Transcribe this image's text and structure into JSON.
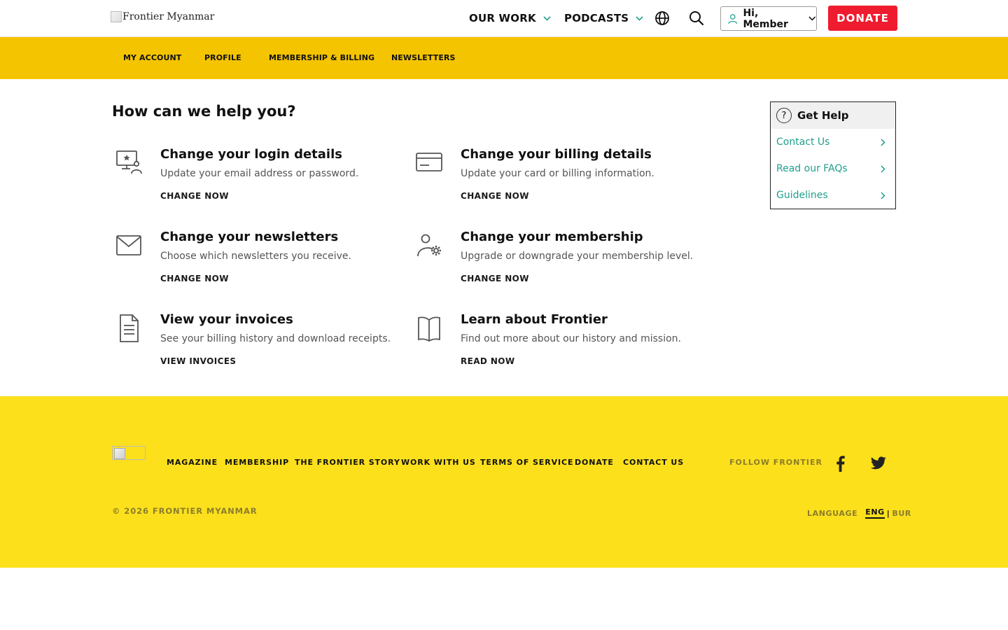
{
  "header": {
    "logo_alt": "Frontier Myanmar",
    "nav": [
      {
        "label": "OUR WORK"
      },
      {
        "label": "PODCASTS"
      }
    ],
    "member_label": "Hi, Member",
    "donate_label": "DONATE"
  },
  "subnav": {
    "items": [
      "MY ACCOUNT",
      "PROFILE",
      "MEMBERSHIP & BILLING",
      "NEWSLETTERS"
    ]
  },
  "main": {
    "title": "How can we help you?",
    "cards": [
      {
        "icon": "user-monitor-icon",
        "title": "Change your login details",
        "desc": "Update your email address or password.",
        "link": "CHANGE NOW"
      },
      {
        "icon": "credit-card-icon",
        "title": "Change your billing details",
        "desc": "Update your card or billing information.",
        "link": "CHANGE NOW"
      },
      {
        "icon": "envelope-icon",
        "title": "Change your newsletters",
        "desc": "Choose which newsletters you receive.",
        "link": "CHANGE NOW"
      },
      {
        "icon": "user-settings-icon",
        "title": "Change your membership",
        "desc": "Upgrade or downgrade your membership level.",
        "link": "CHANGE NOW"
      },
      {
        "icon": "document-icon",
        "title": "View your invoices",
        "desc": "See your billing history and download receipts.",
        "link": "VIEW INVOICES"
      },
      {
        "icon": "book-icon",
        "title": "Learn about Frontier",
        "desc": "Find out more about our history and mission.",
        "link": "READ NOW"
      }
    ]
  },
  "help": {
    "title": "Get Help",
    "items": [
      "Contact Us",
      "Read our FAQs",
      "Guidelines"
    ],
    "link_color": "#1f9f8c"
  },
  "footer": {
    "links": [
      "MAGAZINE",
      "MEMBERSHIP",
      "THE FRONTIER STORY",
      "WORK WITH US",
      "TERMS OF SERVICE",
      "DONATE",
      "CONTACT US"
    ],
    "follow": "FOLLOW FRONTIER",
    "copyright": "© 2026 FRONTIER MYANMAR",
    "language_label": "LANGUAGE",
    "lang_current": "ENG",
    "lang_other": "BUR",
    "background": "#fde01c"
  },
  "colors": {
    "accent_yellow": "#f5c400",
    "donate_red": "#ee1c2e",
    "teal": "#1f9f8c"
  }
}
